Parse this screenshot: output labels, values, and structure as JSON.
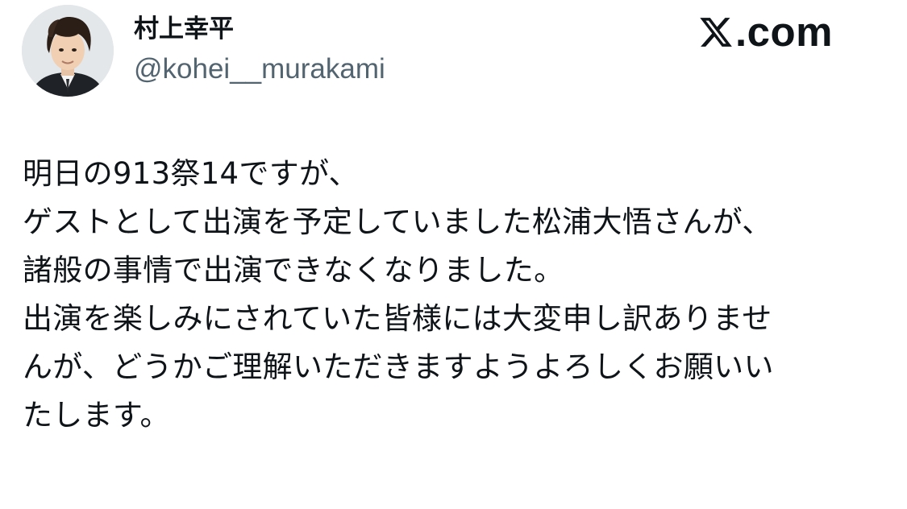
{
  "author": {
    "display_name": "村上幸平",
    "handle": "@kohei__murakami",
    "avatar_icon": "avatar-photo"
  },
  "brand": {
    "icon": "x-logo-icon",
    "text": ".com"
  },
  "tweet": {
    "lines": [
      "明日の913祭14ですが、",
      "ゲストとして出演を予定していました松浦大悟さんが、",
      "諸般の事情で出演できなくなりました。",
      "出演を楽しみにされていた皆様には大変申し訳ありませ",
      "んが、どうかご理解いただきますようよろしくお願いい",
      "たします。"
    ]
  },
  "colors": {
    "text_primary": "#0f1419",
    "text_secondary": "#536471",
    "background": "#ffffff"
  }
}
